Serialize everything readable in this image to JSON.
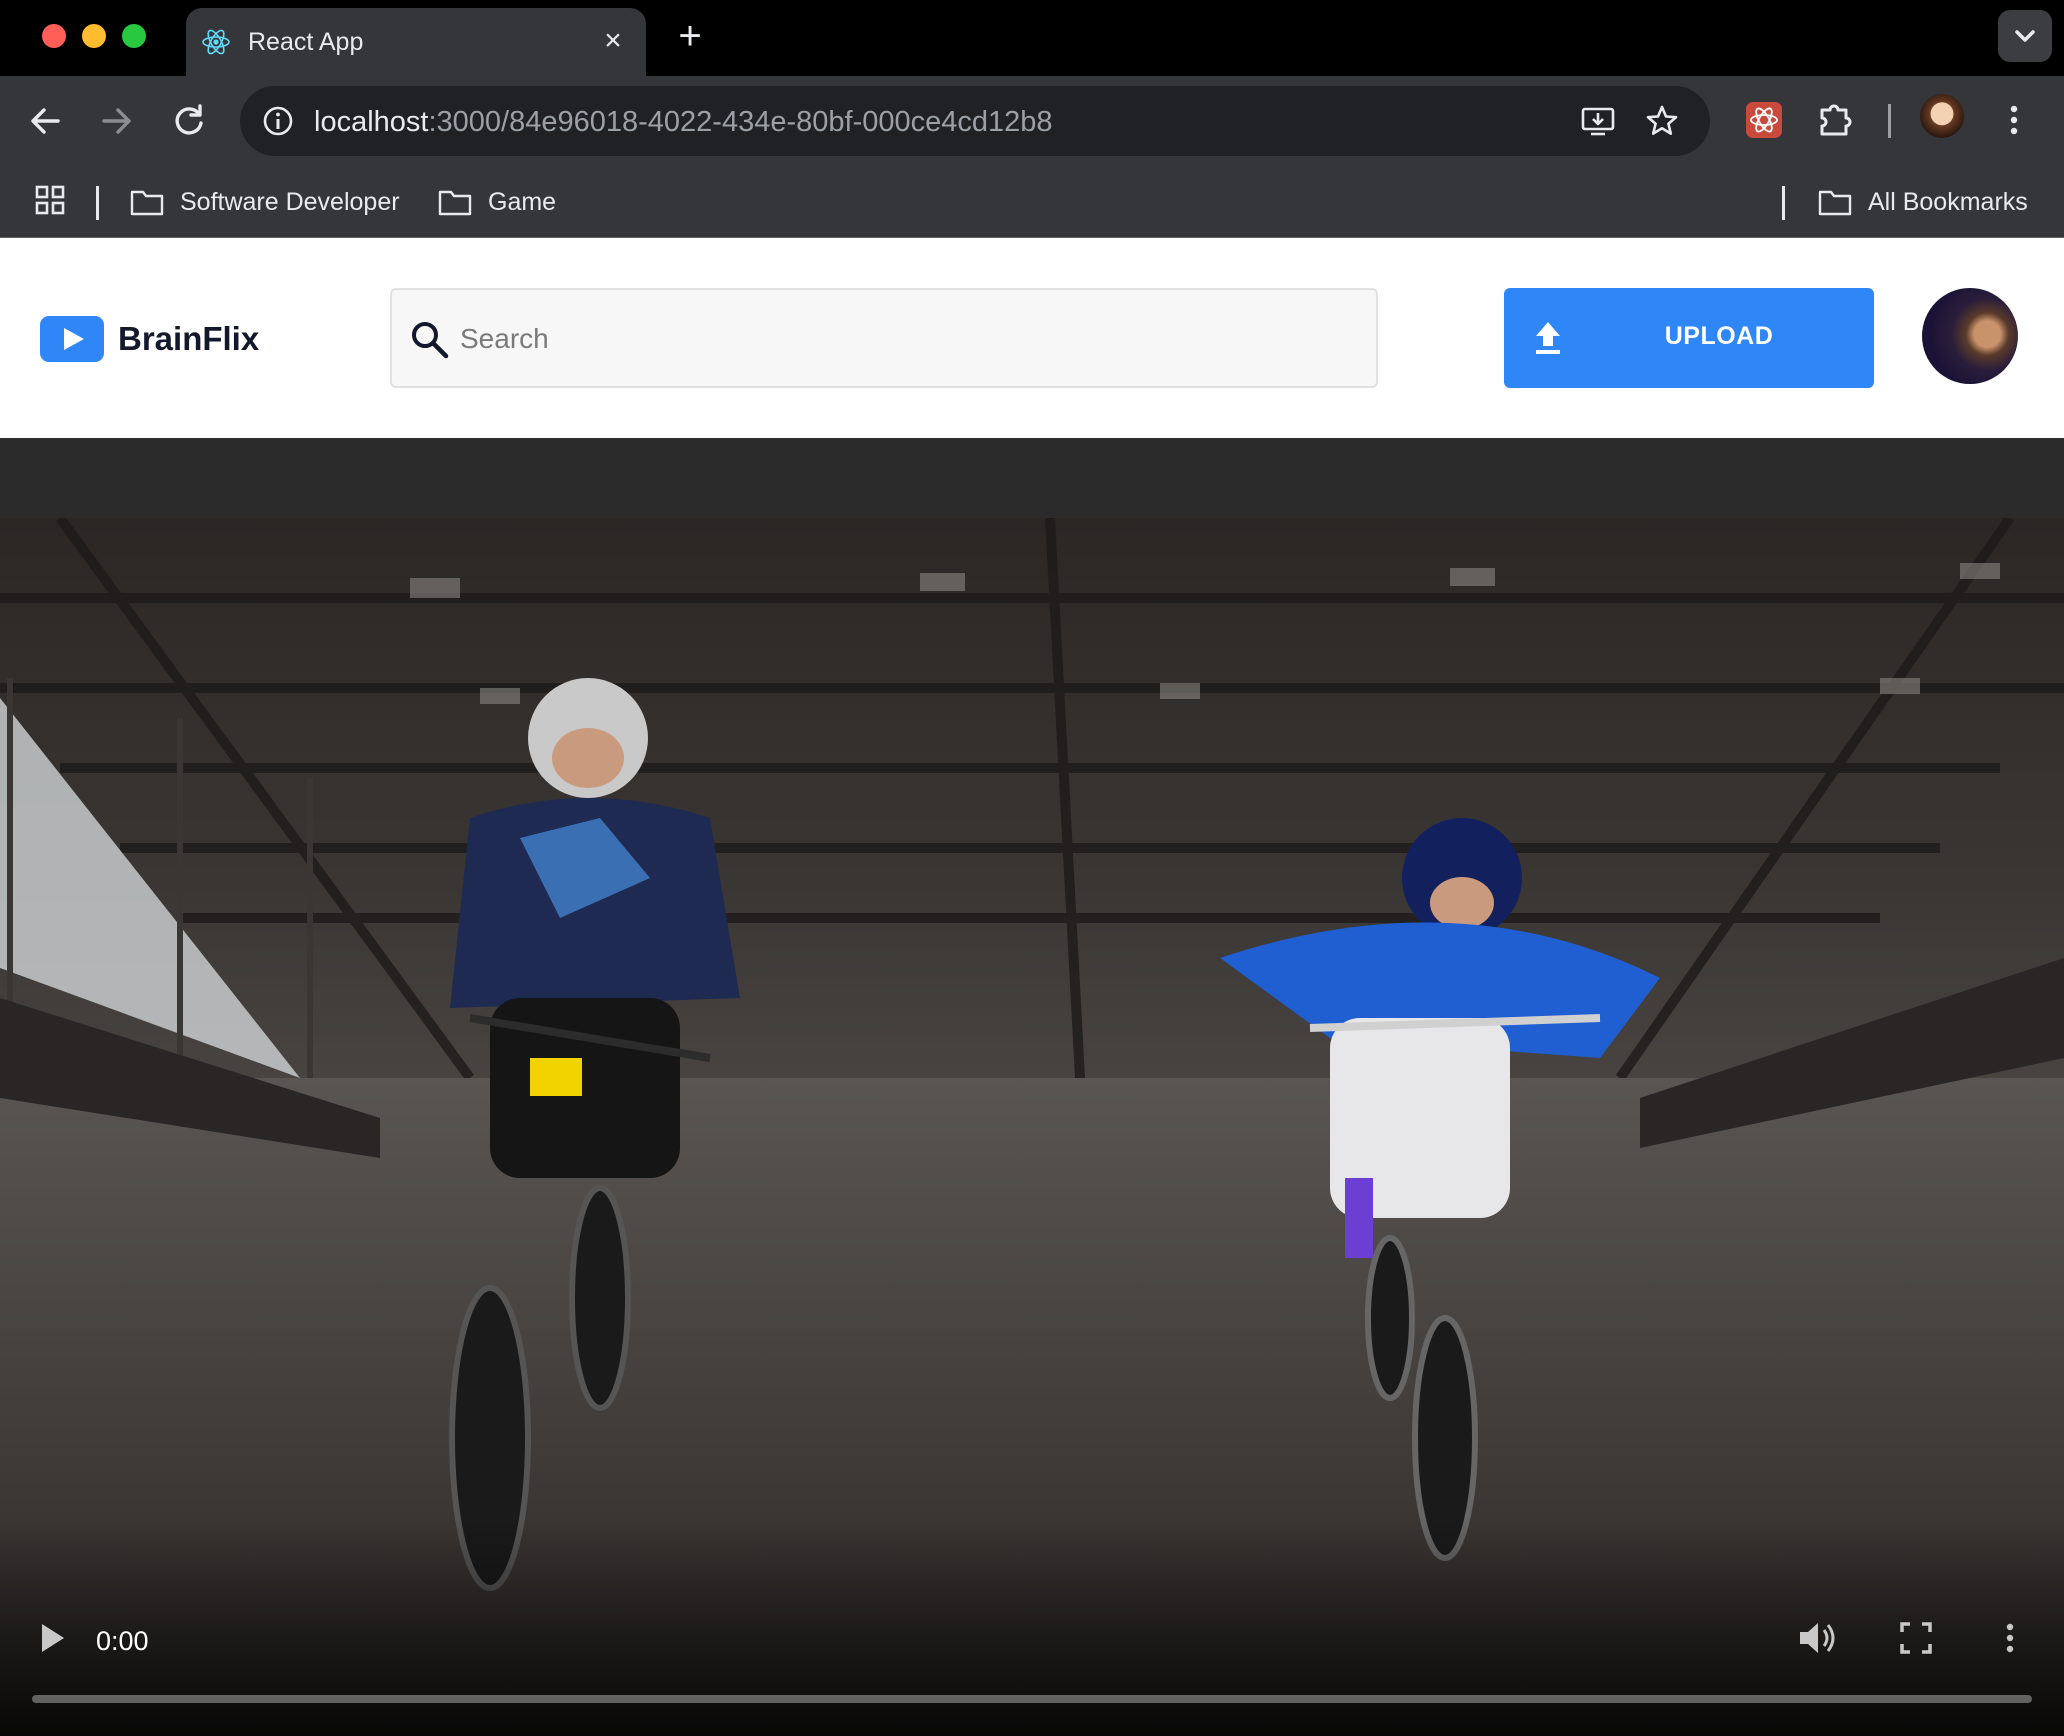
{
  "browser": {
    "tab_title": "React App",
    "url_host": "localhost",
    "url_rest": ":3000/84e96018-4022-434e-80bf-000ce4cd12b8",
    "bookmarks": [
      "Software Developer",
      "Game"
    ],
    "all_bookmarks_label": "All Bookmarks"
  },
  "app": {
    "brand": "BrainFlix",
    "search_placeholder": "Search",
    "upload_label": "UPLOAD"
  },
  "video": {
    "current_time": "0:00",
    "progress": 0
  },
  "colors": {
    "accent": "#2f86f6",
    "brand_text": "#13182c"
  }
}
